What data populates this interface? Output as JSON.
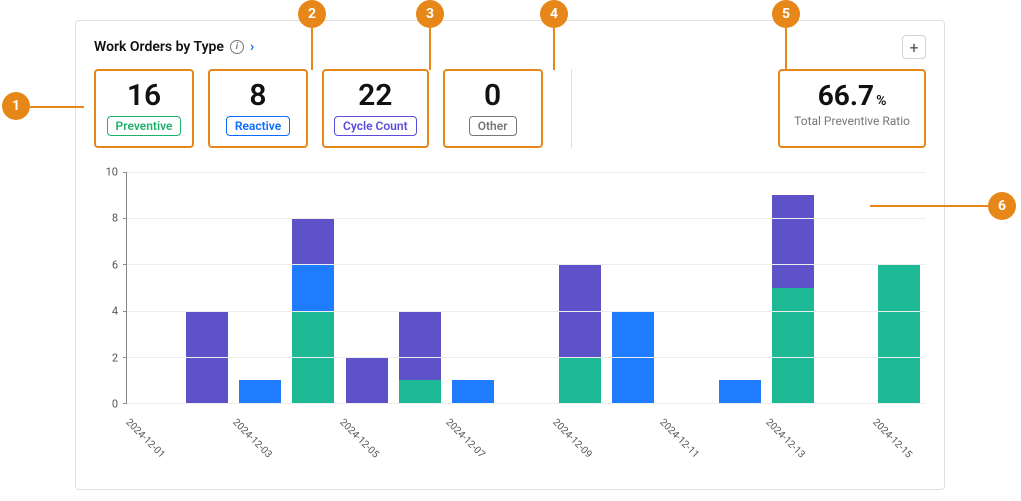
{
  "title": "Work Orders by Type",
  "cards": [
    {
      "value": "16",
      "label": "Preventive",
      "tag_class": "tag-preventive"
    },
    {
      "value": "8",
      "label": "Reactive",
      "tag_class": "tag-reactive"
    },
    {
      "value": "22",
      "label": "Cycle Count",
      "tag_class": "tag-cycle"
    },
    {
      "value": "0",
      "label": "Other",
      "tag_class": "tag-other"
    }
  ],
  "ratio": {
    "value": "66.7",
    "unit": "%",
    "label": "Total Preventive Ratio"
  },
  "callouts": [
    "1",
    "2",
    "3",
    "4",
    "5",
    "6"
  ],
  "chart_data": {
    "type": "bar",
    "stacked": true,
    "ylim": [
      0,
      10
    ],
    "yticks": [
      0,
      2,
      4,
      6,
      8,
      10
    ],
    "categories": [
      "2024-12-01",
      "2024-12-02",
      "2024-12-03",
      "2024-12-04",
      "2024-12-05",
      "2024-12-06",
      "2024-12-07",
      "2024-12-08",
      "2024-12-09",
      "2024-12-10",
      "2024-12-11",
      "2024-12-12",
      "2024-12-13",
      "2024-12-14",
      "2024-12-15"
    ],
    "x_tick_labels": [
      "2024-12-01",
      "",
      "2024-12-03",
      "",
      "2024-12-05",
      "",
      "2024-12-07",
      "",
      "2024-12-09",
      "",
      "2024-12-11",
      "",
      "2024-12-13",
      "",
      "2024-12-15"
    ],
    "series": [
      {
        "name": "Preventive",
        "color": "#1db894",
        "values": [
          0,
          0,
          0,
          4,
          0,
          1,
          0,
          0,
          2,
          0,
          0,
          0,
          5,
          0,
          6
        ]
      },
      {
        "name": "Reactive",
        "color": "#1f7cff",
        "values": [
          0,
          0,
          1,
          2,
          0,
          0,
          1,
          0,
          0,
          4,
          0,
          1,
          0,
          0,
          0
        ]
      },
      {
        "name": "Cycle Count",
        "color": "#5e52c9",
        "values": [
          0,
          4,
          0,
          2,
          2,
          3,
          0,
          0,
          4,
          0,
          0,
          0,
          4,
          0,
          0
        ]
      },
      {
        "name": "Other",
        "color": "#999999",
        "values": [
          0,
          0,
          0,
          0,
          0,
          0,
          0,
          0,
          0,
          0,
          0,
          0,
          0,
          0,
          0
        ]
      }
    ]
  }
}
